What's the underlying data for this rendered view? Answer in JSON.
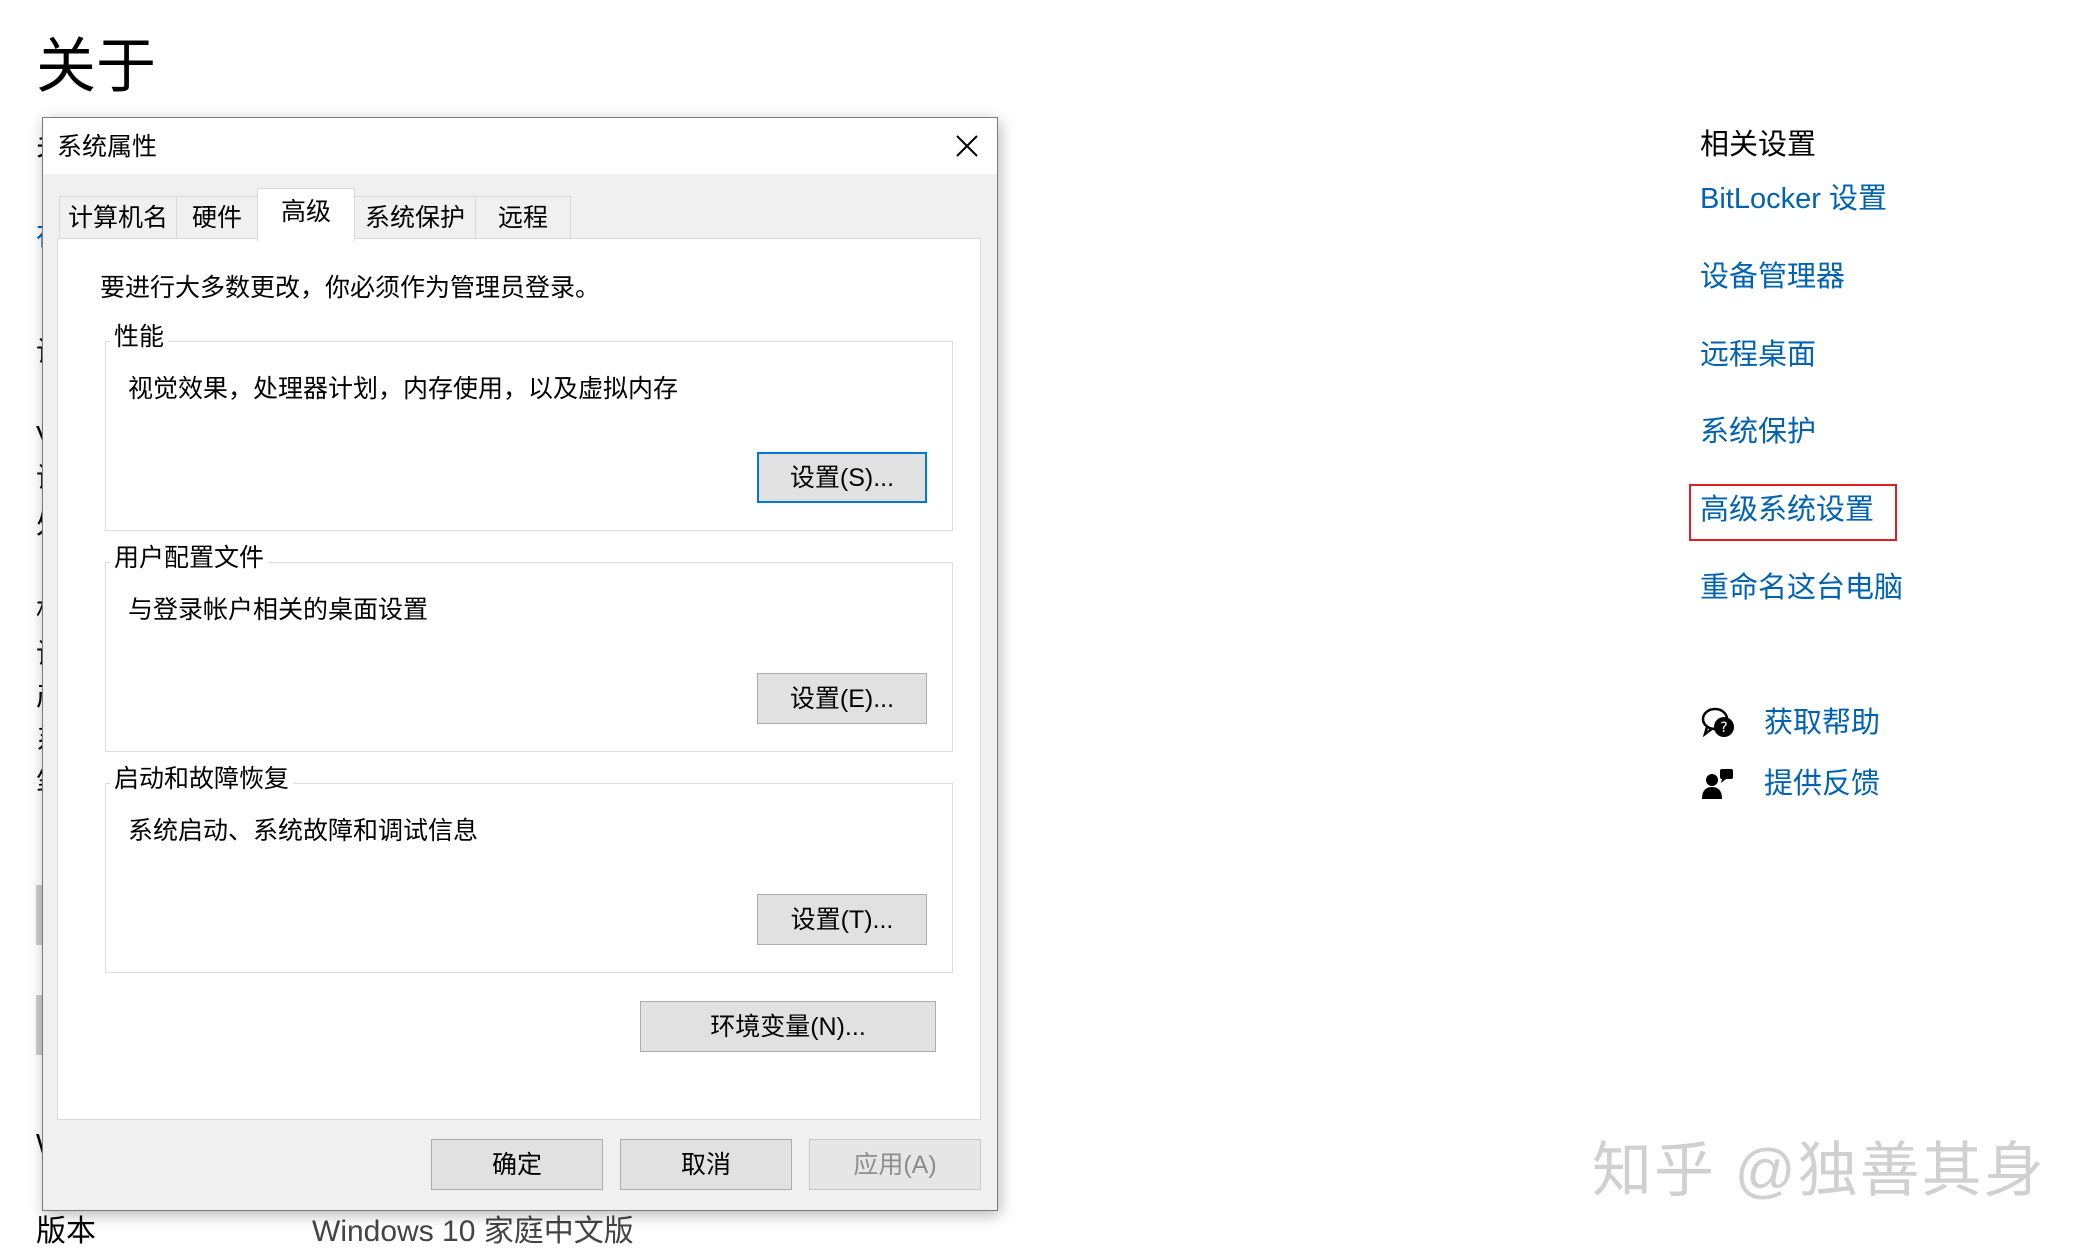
{
  "page": {
    "title": "关于",
    "version_label": "版本",
    "version_value": "Windows 10 家庭中文版"
  },
  "dialog": {
    "title": "系统属性",
    "tabs": [
      {
        "label": "计算机名"
      },
      {
        "label": "硬件"
      },
      {
        "label": "高级",
        "active": true
      },
      {
        "label": "系统保护"
      },
      {
        "label": "远程"
      }
    ],
    "notice": "要进行大多数更改，你必须作为管理员登录。",
    "groups": [
      {
        "legend": "性能",
        "description": "视觉效果，处理器计划，内存使用，以及虚拟内存",
        "button": "设置(S)..."
      },
      {
        "legend": "用户配置文件",
        "description": "与登录帐户相关的桌面设置",
        "button": "设置(E)..."
      },
      {
        "legend": "启动和故障恢复",
        "description": "系统启动、系统故障和调试信息",
        "button": "设置(T)..."
      }
    ],
    "env_button": "环境变量(N)...",
    "ok_button": "确定",
    "cancel_button": "取消",
    "apply_button": "应用(A)"
  },
  "related": {
    "heading": "相关设置",
    "links": [
      "BitLocker 设置",
      "设备管理器",
      "远程桌面",
      "系统保护",
      "高级系统设置",
      "重命名这台电脑"
    ],
    "highlighted": "高级系统设置",
    "help_label": "获取帮助",
    "feedback_label": "提供反馈"
  },
  "watermark": "知乎 @独善其身",
  "icons": {
    "close": "close-icon",
    "help": "chat-help-icon",
    "feedback": "feedback-person-icon"
  },
  "colors": {
    "link": "#0063b1",
    "highlight_border": "#e02020",
    "default_button_border": "#0078d7"
  }
}
